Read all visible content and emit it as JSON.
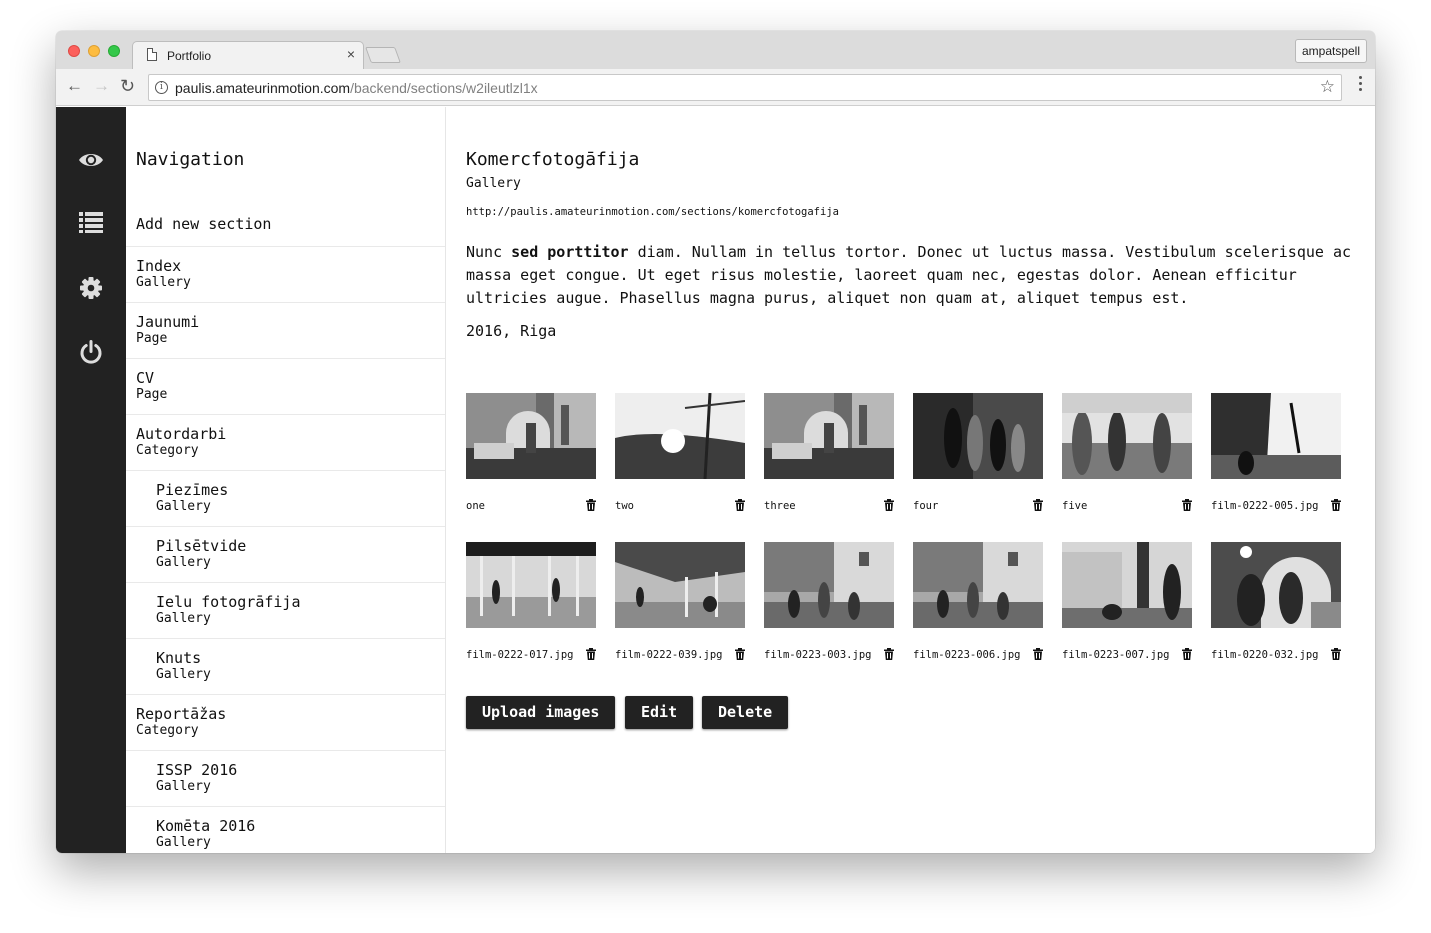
{
  "browser": {
    "tab_title": "Portfolio",
    "tab_close": "×",
    "profile": "ampatspell",
    "url_host": "paulis.amateurinmotion.com",
    "url_path": "/backend/sections/w2ileutlzl1x"
  },
  "iconbar": {
    "items": [
      {
        "name": "eye-icon"
      },
      {
        "name": "list-icon"
      },
      {
        "name": "gear-icon"
      },
      {
        "name": "power-icon"
      }
    ]
  },
  "sidebar": {
    "heading": "Navigation",
    "add_section": "Add new section",
    "items": [
      {
        "name": "Index",
        "type": "Gallery",
        "sub": false
      },
      {
        "name": "Jaunumi",
        "type": "Page",
        "sub": false
      },
      {
        "name": "CV",
        "type": "Page",
        "sub": false
      },
      {
        "name": "Autordarbi",
        "type": "Category",
        "sub": false
      },
      {
        "name": "Piezīmes",
        "type": "Gallery",
        "sub": true
      },
      {
        "name": "Pilsētvide",
        "type": "Gallery",
        "sub": true
      },
      {
        "name": "Ielu fotogrāfija",
        "type": "Gallery",
        "sub": true
      },
      {
        "name": "Knuts",
        "type": "Gallery",
        "sub": true
      },
      {
        "name": "Reportāžas",
        "type": "Category",
        "sub": false
      },
      {
        "name": "ISSP 2016",
        "type": "Gallery",
        "sub": true
      },
      {
        "name": "Komēta 2016",
        "type": "Gallery",
        "sub": true
      }
    ]
  },
  "section": {
    "title": "Komercfotogāfija",
    "type": "Gallery",
    "url": "http://paulis.amateurinmotion.com/sections/komercfotogafija",
    "desc_pre": "Nunc ",
    "desc_bold": "sed porttitor",
    "desc_post": " diam. Nullam in tellus tortor. Donec ut luctus massa. Vestibulum scelerisque ac massa eget congue. Ut eget risus molestie, laoreet quam nec, egestas dolor. Aenean efficitur ultricies augue. Phasellus magna purus, aliquet non quam at, aliquet tempus est.",
    "meta": "2016, Riga"
  },
  "images": [
    {
      "label": "one",
      "scene": "kitchen"
    },
    {
      "label": "two",
      "scene": "sunset"
    },
    {
      "label": "three",
      "scene": "kitchen"
    },
    {
      "label": "four",
      "scene": "group-dark"
    },
    {
      "label": "five",
      "scene": "people-field"
    },
    {
      "label": "film-0222-005.jpg",
      "scene": "trees-figure"
    },
    {
      "label": "film-0222-017.jpg",
      "scene": "pavilion"
    },
    {
      "label": "film-0222-039.jpg",
      "scene": "pavilion-wide"
    },
    {
      "label": "film-0223-003.jpg",
      "scene": "courtyard"
    },
    {
      "label": "film-0223-006.jpg",
      "scene": "courtyard"
    },
    {
      "label": "film-0223-007.jpg",
      "scene": "building-tree"
    },
    {
      "label": "film-0220-032.jpg",
      "scene": "interior-people"
    }
  ],
  "actions": {
    "upload": "Upload images",
    "edit": "Edit",
    "delete": "Delete"
  },
  "colors": {
    "iconbar_bg": "#222222",
    "button_bg": "#222222",
    "icon_fill": "#dddddd"
  }
}
